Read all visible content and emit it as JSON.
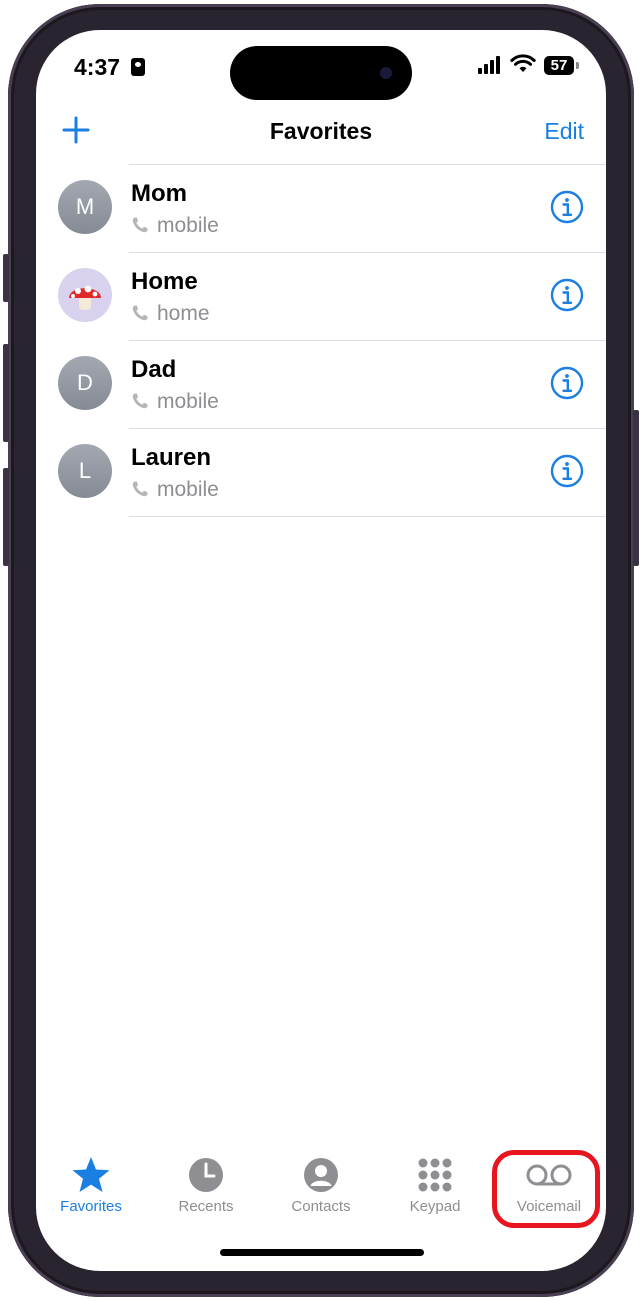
{
  "status_bar": {
    "time": "4:37",
    "battery": "57"
  },
  "nav": {
    "title": "Favorites",
    "edit_label": "Edit",
    "add_icon": "plus-icon"
  },
  "favorites": [
    {
      "name": "Mom",
      "type": "mobile",
      "avatar": "M"
    },
    {
      "name": "Home",
      "type": "home",
      "avatar": "mushroom"
    },
    {
      "name": "Dad",
      "type": "mobile",
      "avatar": "D"
    },
    {
      "name": "Lauren",
      "type": "mobile",
      "avatar": "L"
    }
  ],
  "tabs": [
    {
      "label": "Favorites",
      "icon": "star-icon",
      "active": true
    },
    {
      "label": "Recents",
      "icon": "clock-icon",
      "active": false
    },
    {
      "label": "Contacts",
      "icon": "person-icon",
      "active": false
    },
    {
      "label": "Keypad",
      "icon": "keypad-icon",
      "active": false
    },
    {
      "label": "Voicemail",
      "icon": "voicemail-icon",
      "active": false
    }
  ],
  "colors": {
    "accent": "#1a7fe0",
    "highlight": "#e8141e",
    "secondary_text": "#8e8e93"
  }
}
